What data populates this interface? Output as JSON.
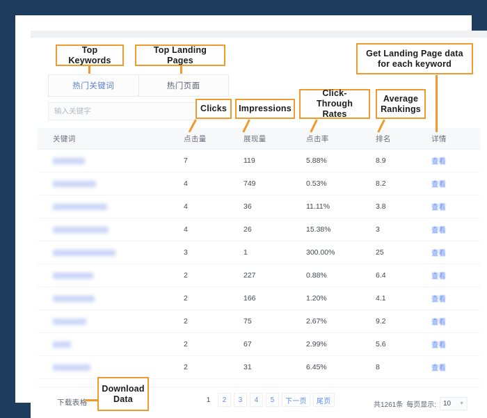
{
  "frame": {
    "border_color": "#1d3c5e"
  },
  "accent": {
    "annotation": "#f0992c",
    "link": "#4c7ced",
    "tab_active": "#5b7fd4"
  },
  "tabs": [
    {
      "label": "热门关键词",
      "active": true
    },
    {
      "label": "热门页面",
      "active": false
    }
  ],
  "search": {
    "placeholder": "输入关键字",
    "value": ""
  },
  "table": {
    "headers": [
      "关键词",
      "点击量",
      "展现量",
      "点击率",
      "排名",
      "详情"
    ],
    "detail_link_label": "查看",
    "rows": [
      {
        "keyword": "",
        "keyword_redacted_width": 46,
        "clicks": "7",
        "impressions": "119",
        "ctr": "5.88%",
        "rank": "8.9",
        "detail": "查看"
      },
      {
        "keyword": "",
        "keyword_redacted_width": 62,
        "clicks": "4",
        "impressions": "749",
        "ctr": "0.53%",
        "rank": "8.2",
        "detail": "查看"
      },
      {
        "keyword": "",
        "keyword_redacted_width": 78,
        "clicks": "4",
        "impressions": "36",
        "ctr": "11.11%",
        "rank": "3.8",
        "detail": "查看"
      },
      {
        "keyword": "",
        "keyword_redacted_width": 80,
        "clicks": "4",
        "impressions": "26",
        "ctr": "15.38%",
        "rank": "3",
        "detail": "查看"
      },
      {
        "keyword": "",
        "keyword_redacted_width": 90,
        "clicks": "3",
        "impressions": "1",
        "ctr": "300.00%",
        "rank": "25",
        "detail": "查看"
      },
      {
        "keyword": "",
        "keyword_redacted_width": 58,
        "clicks": "2",
        "impressions": "227",
        "ctr": "0.88%",
        "rank": "6.4",
        "detail": "查看"
      },
      {
        "keyword": "",
        "keyword_redacted_width": 60,
        "clicks": "2",
        "impressions": "166",
        "ctr": "1.20%",
        "rank": "4.1",
        "detail": "查看"
      },
      {
        "keyword": "",
        "keyword_redacted_width": 48,
        "clicks": "2",
        "impressions": "75",
        "ctr": "2.67%",
        "rank": "9.2",
        "detail": "查看"
      },
      {
        "keyword": "",
        "keyword_redacted_width": 26,
        "clicks": "2",
        "impressions": "67",
        "ctr": "2.99%",
        "rank": "5.6",
        "detail": "查看"
      },
      {
        "keyword": "",
        "keyword_redacted_width": 54,
        "clicks": "2",
        "impressions": "31",
        "ctr": "6.45%",
        "rank": "8",
        "detail": "查看"
      }
    ]
  },
  "footer": {
    "download_label": "下载表格",
    "pagination": [
      {
        "label": "1",
        "current": true
      },
      {
        "label": "2",
        "current": false
      },
      {
        "label": "3",
        "current": false
      },
      {
        "label": "4",
        "current": false
      },
      {
        "label": "5",
        "current": false
      },
      {
        "label": "下一页",
        "current": false
      },
      {
        "label": "尾页",
        "current": false
      }
    ],
    "total_text": "共1261条",
    "page_size_label": "每页显示:",
    "page_size_value": "10"
  },
  "annotations": [
    {
      "id": "top-keywords",
      "text": "Top Keywords"
    },
    {
      "id": "top-landing-pages",
      "text": "Top Landing Pages"
    },
    {
      "id": "clicks",
      "text": "Clicks"
    },
    {
      "id": "impressions",
      "text": "Impressions"
    },
    {
      "id": "click-through-rates",
      "text": "Click-Through Rates"
    },
    {
      "id": "average-rankings",
      "text": "Average Rankings"
    },
    {
      "id": "landing-page-data",
      "text": "Get Landing Page data for each keyword"
    },
    {
      "id": "download-data",
      "text": "Download Data"
    }
  ]
}
